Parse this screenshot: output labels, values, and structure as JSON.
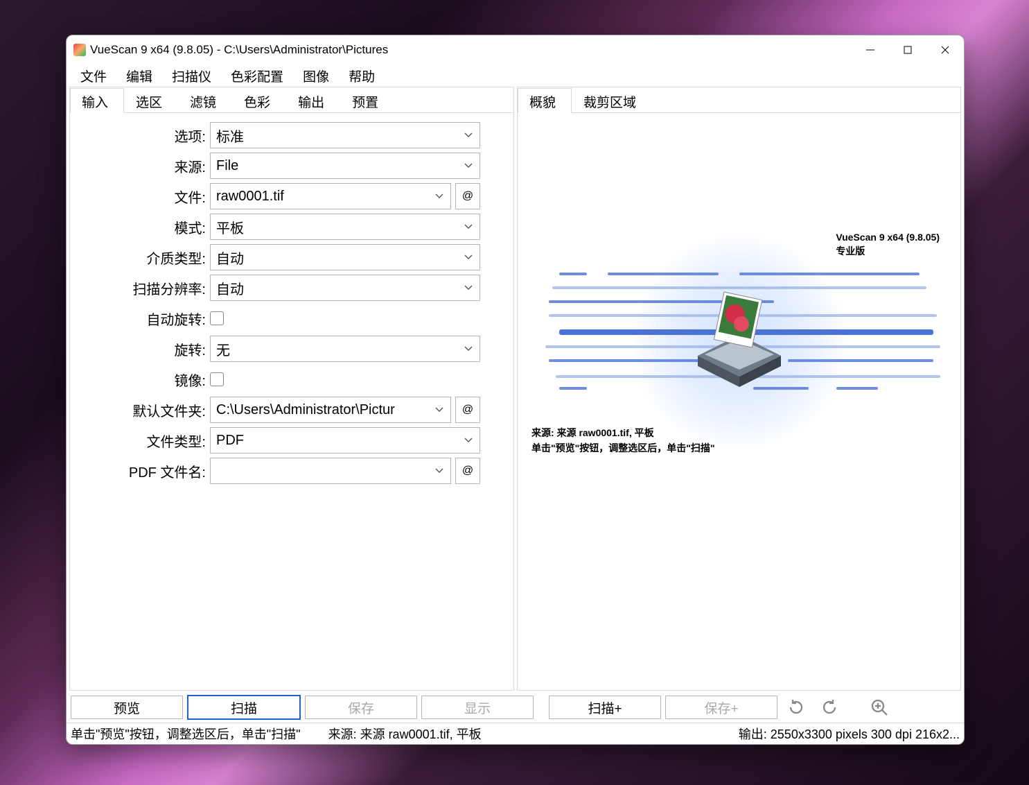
{
  "window": {
    "title": "VueScan 9 x64 (9.8.05) - C:\\Users\\Administrator\\Pictures"
  },
  "menu": [
    "文件",
    "编辑",
    "扫描仪",
    "色彩配置",
    "图像",
    "帮助"
  ],
  "left_tabs": [
    "输入",
    "选区",
    "滤镜",
    "色彩",
    "输出",
    "预置"
  ],
  "right_tabs": [
    "概貌",
    "裁剪区域"
  ],
  "options": {
    "options_label": "选项:",
    "options_value": "标准",
    "source_label": "来源:",
    "source_value": "File",
    "file_label": "文件:",
    "file_value": "raw0001.tif",
    "mode_label": "模式:",
    "mode_value": "平板",
    "media_label": "介质类型:",
    "media_value": "自动",
    "dpi_label": "扫描分辨率:",
    "dpi_value": "自动",
    "autorotate_label": "自动旋转:",
    "rotate_label": "旋转:",
    "rotate_value": "无",
    "mirror_label": "镜像:",
    "folder_label": "默认文件夹:",
    "folder_value": "C:\\Users\\Administrator\\Pictur",
    "filetype_label": "文件类型:",
    "filetype_value": "PDF",
    "pdfname_label": "PDF 文件名:",
    "pdfname_value": "",
    "at": "@"
  },
  "preview": {
    "product": "VueScan 9 x64 (9.8.05)",
    "edition": "专业版",
    "source_line": "来源: 来源 raw0001.tif, 平板",
    "hint_line": "单击\"预览\"按钮，调整选区后，单击\"扫描\""
  },
  "buttons": {
    "preview": "预览",
    "scan": "扫描",
    "save": "保存",
    "show": "显示",
    "scanplus": "扫描+",
    "saveplus": "保存+"
  },
  "status": {
    "left": "单击\"预览\"按钮，调整选区后，单击\"扫描\"",
    "mid": "来源: 来源 raw0001.tif, 平板",
    "right": "输出: 2550x3300 pixels 300 dpi 216x2..."
  }
}
